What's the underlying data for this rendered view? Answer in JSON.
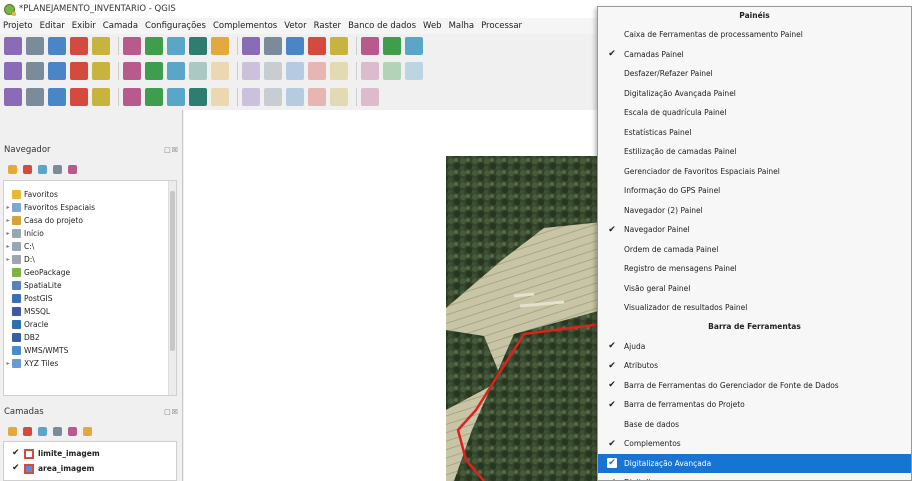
{
  "window": {
    "title": "*PLANEJAMENTO_INVENTARIO - QGIS"
  },
  "menubar": {
    "items": [
      "Projeto",
      "Editar",
      "Exibir",
      "Camada",
      "Configurações",
      "Complementos",
      "Vetor",
      "Raster",
      "Banco de dados",
      "Web",
      "Malha",
      "Processar"
    ]
  },
  "toolbar_icons": {
    "row1": [
      "new-project-icon",
      "open-project-icon",
      "save-project-icon",
      "new-print-layout-icon",
      "layout-manager-icon",
      "pan-icon",
      "pan-to-selection-icon",
      "zoom-in-icon",
      "zoom-out-icon",
      "zoom-full-icon",
      "zoom-to-selection-icon",
      "zoom-to-layer-icon",
      "zoom-last-icon",
      "zoom-next-icon",
      "map-tips-icon",
      "new-bookmark-icon",
      "show-bookmarks-icon",
      "refresh-icon"
    ],
    "row2": [
      "digitize-vector-icon",
      "edit-icon",
      "vertex-tool-icon",
      "digitize-shape-icon",
      "add-polygon-icon",
      "save-edits-icon",
      "pencil-edit-icon",
      "save-layer-edits-icon",
      "add-feature-icon",
      "move-feature-icon",
      "delete-selected-icon",
      "cut-features-icon",
      "copy-features-icon",
      "paste-features-icon",
      "undo-icon",
      "redo-icon",
      "label-icon",
      "pin-icon"
    ],
    "row3": [
      "layer-styling-icon",
      "add-vector-layer-icon",
      "add-raster-layer-icon",
      "add-spatialite-icon",
      "add-postgis-icon",
      "add-wms-icon",
      "add-wfs-icon",
      "add-delimited-text-icon",
      "add-virtual-layer-icon",
      "add-mesh-icon",
      "new-shapefile-icon",
      "new-geopackage-icon",
      "new-temporary-layer-icon",
      "add-gps-icon",
      "add-vector-tile-icon",
      "add-point-cloud-icon"
    ]
  },
  "browser_panel": {
    "title": "Navegador",
    "buttons": "□☒",
    "tools": [
      "add-selected-layers-icon",
      "refresh-browser-icon",
      "filter-browser-icon",
      "collapse-all-icon",
      "enable-properties-icon"
    ],
    "items": [
      {
        "label": "Favoritos",
        "icon": "star-icon",
        "expand": ""
      },
      {
        "label": "Favoritos Espaciais",
        "icon": "spatial-bookmarks-icon",
        "expand": "▸"
      },
      {
        "label": "Casa do projeto",
        "icon": "project-home-folder-icon",
        "expand": "▸"
      },
      {
        "label": "Início",
        "icon": "home-folder-icon",
        "expand": "▸"
      },
      {
        "label": "C:\\",
        "icon": "drive-icon",
        "expand": "▸"
      },
      {
        "label": "D:\\",
        "icon": "drive-icon",
        "expand": "▸"
      },
      {
        "label": "GeoPackage",
        "icon": "geopackage-icon",
        "expand": ""
      },
      {
        "label": "SpatiaLite",
        "icon": "spatialite-icon",
        "expand": ""
      },
      {
        "label": "PostGIS",
        "icon": "postgis-icon",
        "expand": ""
      },
      {
        "label": "MSSQL",
        "icon": "mssql-icon",
        "expand": ""
      },
      {
        "label": "Oracle",
        "icon": "oracle-icon",
        "expand": ""
      },
      {
        "label": "DB2",
        "icon": "db2-icon",
        "expand": ""
      },
      {
        "label": "WMS/WMTS",
        "icon": "wms-icon",
        "expand": ""
      },
      {
        "label": "XYZ Tiles",
        "icon": "xyz-tiles-icon",
        "expand": "▸"
      }
    ]
  },
  "layers_panel": {
    "title": "Camadas",
    "buttons": "□☒",
    "tools": [
      "open-layer-styling-icon",
      "add-group-icon",
      "manage-map-themes-icon",
      "filter-legend-icon",
      "filter-by-expression-icon",
      "expand-all-icon"
    ],
    "layers": [
      {
        "name": "limite_imagem",
        "checked": "✔",
        "icon": "polygon-layer-icon"
      },
      {
        "name": "area_imagem",
        "checked": "✔",
        "icon": "polygon-layer-icon"
      }
    ]
  },
  "popup_menu": {
    "panels_header": "Painéis",
    "panels": [
      {
        "label": "Caixa de Ferramentas de processamento Painel",
        "checked": ""
      },
      {
        "label": "Camadas Painel",
        "checked": "✔"
      },
      {
        "label": "Desfazer/Refazer Painel",
        "checked": ""
      },
      {
        "label": "Digitalização Avançada Painel",
        "checked": ""
      },
      {
        "label": "Escala de quadrícula Painel",
        "checked": ""
      },
      {
        "label": "Estatísticas Painel",
        "checked": ""
      },
      {
        "label": "Estilização de camadas Painel",
        "checked": ""
      },
      {
        "label": "Gerenciador de Favoritos Espaciais Painel",
        "checked": ""
      },
      {
        "label": "Informação do GPS Painel",
        "checked": ""
      },
      {
        "label": "Navegador (2) Painel",
        "checked": ""
      },
      {
        "label": "Navegador Painel",
        "checked": "✔"
      },
      {
        "label": "Ordem de camada Painel",
        "checked": ""
      },
      {
        "label": "Registro de mensagens Painel",
        "checked": ""
      },
      {
        "label": "Visão geral Painel",
        "checked": ""
      },
      {
        "label": "Visualizador de resultados Painel",
        "checked": ""
      }
    ],
    "toolbars_header": "Barra de Ferramentas",
    "toolbars": [
      {
        "label": "Ajuda",
        "checked": "✔",
        "highlighted": false
      },
      {
        "label": "Atributos",
        "checked": "✔",
        "highlighted": false
      },
      {
        "label": "Barra de Ferramentas do Gerenciador de Fonte de Dados",
        "checked": "✔",
        "highlighted": false
      },
      {
        "label": "Barra de ferramentas do Projeto",
        "checked": "✔",
        "highlighted": false
      },
      {
        "label": "Base de dados",
        "checked": "",
        "highlighted": false
      },
      {
        "label": "Complementos",
        "checked": "✔",
        "highlighted": false
      },
      {
        "label": "Digitalização Avançada",
        "checked": "✔",
        "highlighted": true
      },
      {
        "label": "Digitalizar",
        "checked": "✔",
        "highlighted": false
      }
    ]
  },
  "colors": {
    "highlight": "#1874d3",
    "vector_boundary": "#e0201e",
    "forest_dark": "#2f4026",
    "field_light": "#c8c5a7",
    "qgis_green": "#7cb342"
  }
}
